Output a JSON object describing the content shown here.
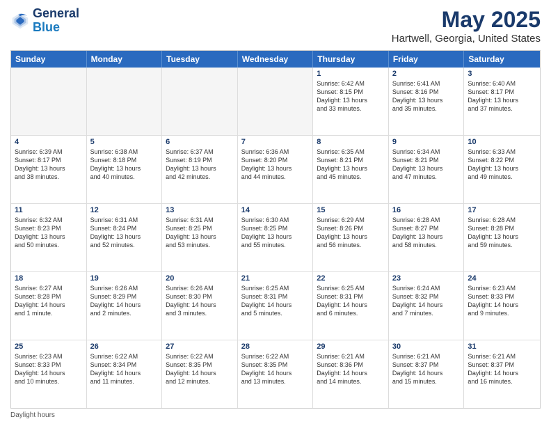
{
  "header": {
    "logo_line1": "General",
    "logo_line2": "Blue",
    "title": "May 2025",
    "subtitle": "Hartwell, Georgia, United States"
  },
  "days_of_week": [
    "Sunday",
    "Monday",
    "Tuesday",
    "Wednesday",
    "Thursday",
    "Friday",
    "Saturday"
  ],
  "footer": "Daylight hours",
  "weeks": [
    [
      {
        "num": "",
        "info": "",
        "empty": true
      },
      {
        "num": "",
        "info": "",
        "empty": true
      },
      {
        "num": "",
        "info": "",
        "empty": true
      },
      {
        "num": "",
        "info": "",
        "empty": true
      },
      {
        "num": "1",
        "info": "Sunrise: 6:42 AM\nSunset: 8:15 PM\nDaylight: 13 hours\nand 33 minutes.",
        "empty": false
      },
      {
        "num": "2",
        "info": "Sunrise: 6:41 AM\nSunset: 8:16 PM\nDaylight: 13 hours\nand 35 minutes.",
        "empty": false
      },
      {
        "num": "3",
        "info": "Sunrise: 6:40 AM\nSunset: 8:17 PM\nDaylight: 13 hours\nand 37 minutes.",
        "empty": false
      }
    ],
    [
      {
        "num": "4",
        "info": "Sunrise: 6:39 AM\nSunset: 8:17 PM\nDaylight: 13 hours\nand 38 minutes.",
        "empty": false
      },
      {
        "num": "5",
        "info": "Sunrise: 6:38 AM\nSunset: 8:18 PM\nDaylight: 13 hours\nand 40 minutes.",
        "empty": false
      },
      {
        "num": "6",
        "info": "Sunrise: 6:37 AM\nSunset: 8:19 PM\nDaylight: 13 hours\nand 42 minutes.",
        "empty": false
      },
      {
        "num": "7",
        "info": "Sunrise: 6:36 AM\nSunset: 8:20 PM\nDaylight: 13 hours\nand 44 minutes.",
        "empty": false
      },
      {
        "num": "8",
        "info": "Sunrise: 6:35 AM\nSunset: 8:21 PM\nDaylight: 13 hours\nand 45 minutes.",
        "empty": false
      },
      {
        "num": "9",
        "info": "Sunrise: 6:34 AM\nSunset: 8:21 PM\nDaylight: 13 hours\nand 47 minutes.",
        "empty": false
      },
      {
        "num": "10",
        "info": "Sunrise: 6:33 AM\nSunset: 8:22 PM\nDaylight: 13 hours\nand 49 minutes.",
        "empty": false
      }
    ],
    [
      {
        "num": "11",
        "info": "Sunrise: 6:32 AM\nSunset: 8:23 PM\nDaylight: 13 hours\nand 50 minutes.",
        "empty": false
      },
      {
        "num": "12",
        "info": "Sunrise: 6:31 AM\nSunset: 8:24 PM\nDaylight: 13 hours\nand 52 minutes.",
        "empty": false
      },
      {
        "num": "13",
        "info": "Sunrise: 6:31 AM\nSunset: 8:25 PM\nDaylight: 13 hours\nand 53 minutes.",
        "empty": false
      },
      {
        "num": "14",
        "info": "Sunrise: 6:30 AM\nSunset: 8:25 PM\nDaylight: 13 hours\nand 55 minutes.",
        "empty": false
      },
      {
        "num": "15",
        "info": "Sunrise: 6:29 AM\nSunset: 8:26 PM\nDaylight: 13 hours\nand 56 minutes.",
        "empty": false
      },
      {
        "num": "16",
        "info": "Sunrise: 6:28 AM\nSunset: 8:27 PM\nDaylight: 13 hours\nand 58 minutes.",
        "empty": false
      },
      {
        "num": "17",
        "info": "Sunrise: 6:28 AM\nSunset: 8:28 PM\nDaylight: 13 hours\nand 59 minutes.",
        "empty": false
      }
    ],
    [
      {
        "num": "18",
        "info": "Sunrise: 6:27 AM\nSunset: 8:28 PM\nDaylight: 14 hours\nand 1 minute.",
        "empty": false
      },
      {
        "num": "19",
        "info": "Sunrise: 6:26 AM\nSunset: 8:29 PM\nDaylight: 14 hours\nand 2 minutes.",
        "empty": false
      },
      {
        "num": "20",
        "info": "Sunrise: 6:26 AM\nSunset: 8:30 PM\nDaylight: 14 hours\nand 3 minutes.",
        "empty": false
      },
      {
        "num": "21",
        "info": "Sunrise: 6:25 AM\nSunset: 8:31 PM\nDaylight: 14 hours\nand 5 minutes.",
        "empty": false
      },
      {
        "num": "22",
        "info": "Sunrise: 6:25 AM\nSunset: 8:31 PM\nDaylight: 14 hours\nand 6 minutes.",
        "empty": false
      },
      {
        "num": "23",
        "info": "Sunrise: 6:24 AM\nSunset: 8:32 PM\nDaylight: 14 hours\nand 7 minutes.",
        "empty": false
      },
      {
        "num": "24",
        "info": "Sunrise: 6:23 AM\nSunset: 8:33 PM\nDaylight: 14 hours\nand 9 minutes.",
        "empty": false
      }
    ],
    [
      {
        "num": "25",
        "info": "Sunrise: 6:23 AM\nSunset: 8:33 PM\nDaylight: 14 hours\nand 10 minutes.",
        "empty": false
      },
      {
        "num": "26",
        "info": "Sunrise: 6:22 AM\nSunset: 8:34 PM\nDaylight: 14 hours\nand 11 minutes.",
        "empty": false
      },
      {
        "num": "27",
        "info": "Sunrise: 6:22 AM\nSunset: 8:35 PM\nDaylight: 14 hours\nand 12 minutes.",
        "empty": false
      },
      {
        "num": "28",
        "info": "Sunrise: 6:22 AM\nSunset: 8:35 PM\nDaylight: 14 hours\nand 13 minutes.",
        "empty": false
      },
      {
        "num": "29",
        "info": "Sunrise: 6:21 AM\nSunset: 8:36 PM\nDaylight: 14 hours\nand 14 minutes.",
        "empty": false
      },
      {
        "num": "30",
        "info": "Sunrise: 6:21 AM\nSunset: 8:37 PM\nDaylight: 14 hours\nand 15 minutes.",
        "empty": false
      },
      {
        "num": "31",
        "info": "Sunrise: 6:21 AM\nSunset: 8:37 PM\nDaylight: 14 hours\nand 16 minutes.",
        "empty": false
      }
    ]
  ]
}
